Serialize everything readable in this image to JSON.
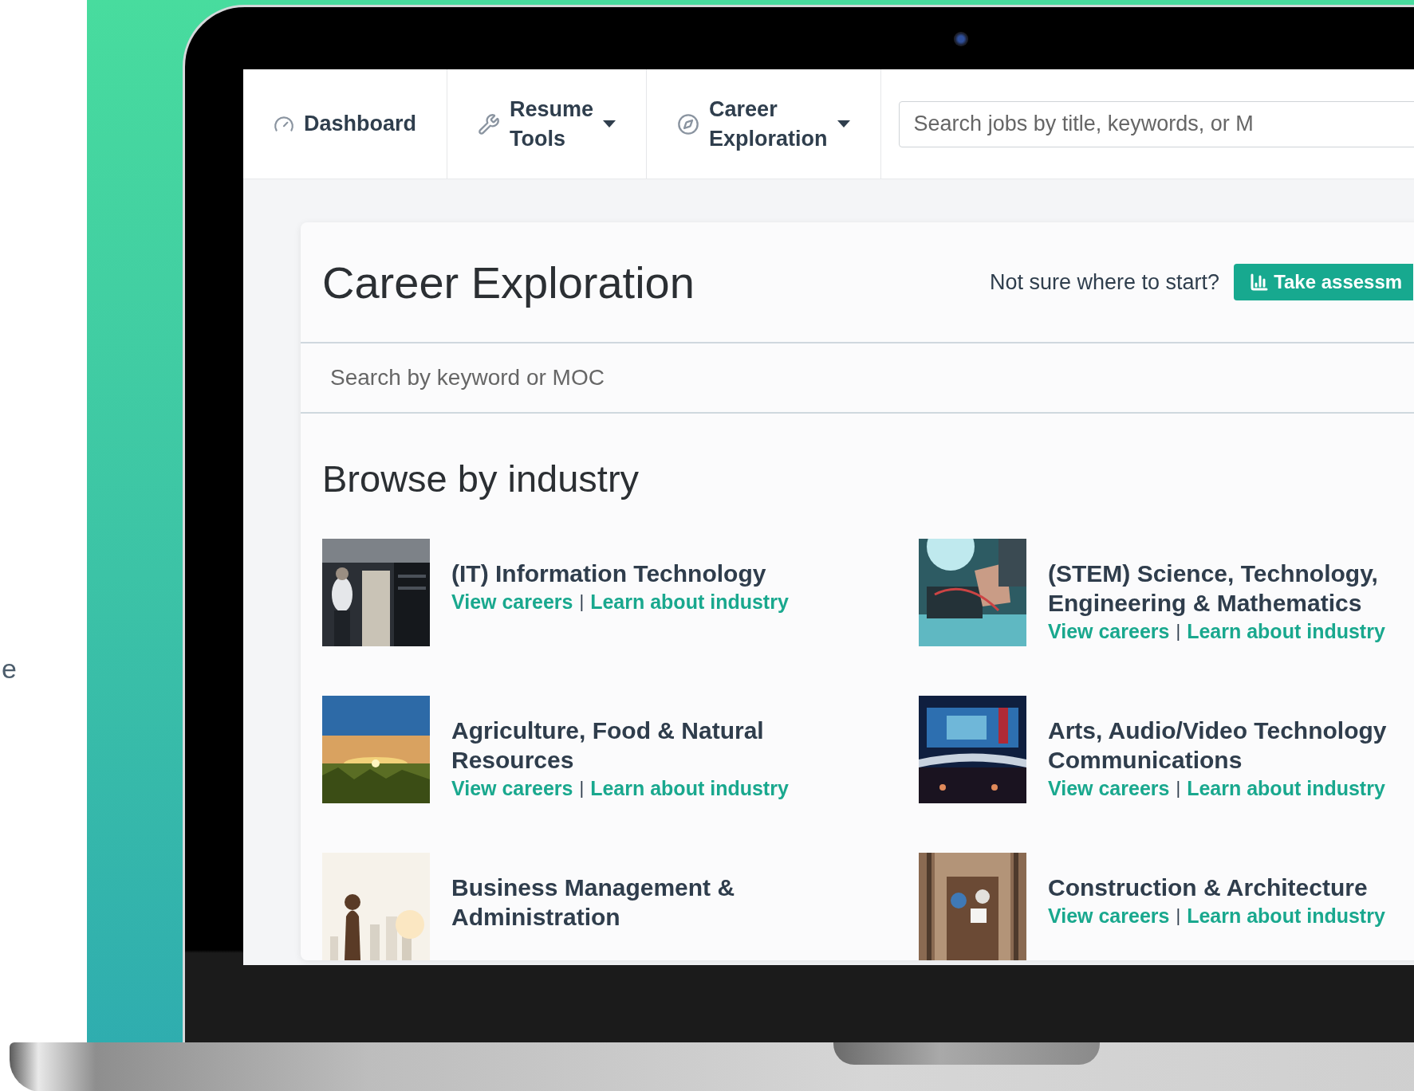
{
  "side_text": "e",
  "nav": {
    "items": [
      {
        "label": "Dashboard",
        "dropdown": false
      },
      {
        "label": "Resume Tools",
        "dropdown": true
      },
      {
        "label": "Career Exploration",
        "dropdown": true
      }
    ],
    "search": {
      "placeholder": "Search jobs by title, keywords, or M"
    }
  },
  "page": {
    "title": "Career Exploration",
    "prompt": "Not sure where to start?",
    "button": "Take assessm",
    "search": {
      "placeholder": "Search by keyword or MOC"
    },
    "section_title": "Browse by industry",
    "industries": [
      {
        "title": "(IT) Information Technology",
        "links": [
          "View careers",
          "Learn about industry"
        ],
        "separator": "|",
        "kind": "picture"
      },
      {
        "title": "(STEM) Science, Technology, Engineering & Mathematics",
        "links": [
          "View careers",
          "Learn about industry"
        ],
        "separator": "|",
        "kind": "picture"
      },
      {
        "title": "Agriculture, Food & Natural Resources",
        "links": [
          "View careers",
          "Learn about industry"
        ],
        "separator": "|",
        "kind": "picture"
      },
      {
        "title": "Arts, Audio/Video Technology Communications",
        "links": [
          "View careers",
          "Learn about industry"
        ],
        "separator": "|",
        "kind": "picture"
      },
      {
        "title": "Business Management & Administration",
        "kind": "picture"
      },
      {
        "title": "Construction & Architecture",
        "links": [
          "View careers",
          "Learn about industry"
        ],
        "separator": "|",
        "kind": "picture"
      }
    ]
  }
}
